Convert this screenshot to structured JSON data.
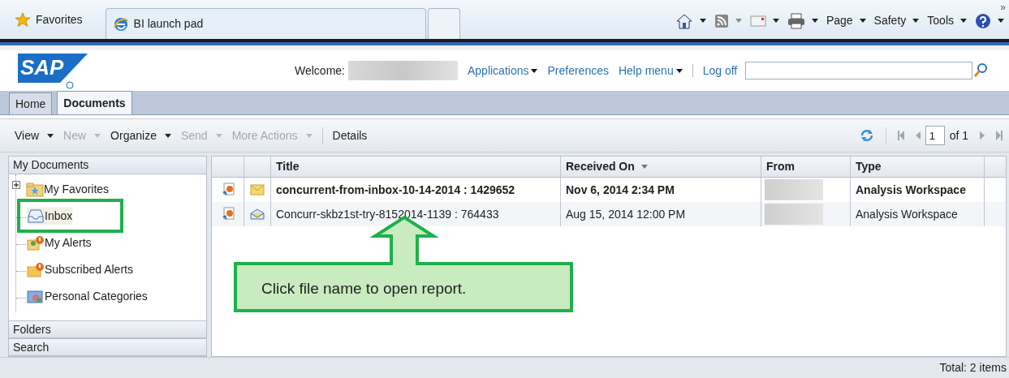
{
  "browser": {
    "favorites": "Favorites",
    "tabs": [
      {
        "label": "BI launch pad",
        "selected": true
      },
      {
        "selected": false
      }
    ],
    "commands": [
      {
        "kind": "home"
      },
      {
        "kind": "feed"
      },
      {
        "kind": "mail"
      },
      {
        "kind": "print"
      },
      {
        "kind": "menu",
        "label": "Page"
      },
      {
        "kind": "menu",
        "label": "Safety"
      },
      {
        "kind": "menu",
        "label": "Tools"
      },
      {
        "kind": "help"
      }
    ],
    "overflow": "»"
  },
  "header": {
    "logo": "SAP",
    "welcome": "Welcome:",
    "links": [
      {
        "label": "Applications",
        "menu": true
      },
      {
        "label": "Preferences",
        "menu": false
      },
      {
        "label": "Help menu",
        "menu": true
      },
      {
        "label": "Log off",
        "menu": false
      }
    ]
  },
  "app_tabs": [
    {
      "label": "Home",
      "selected": false
    },
    {
      "label": "Documents",
      "selected": true
    }
  ],
  "toolbar": {
    "items": [
      {
        "label": "View",
        "menu": true,
        "disabled": false
      },
      {
        "label": "New",
        "menu": true,
        "disabled": true
      },
      {
        "label": "Organize",
        "menu": true,
        "disabled": false
      },
      {
        "label": "Send",
        "menu": true,
        "disabled": true
      },
      {
        "label": "More Actions",
        "menu": true,
        "disabled": true
      },
      {
        "label": "Details",
        "menu": false,
        "disabled": false
      }
    ],
    "page": "1",
    "page_total": "of 1"
  },
  "sidebar": {
    "sections": [
      "My Documents",
      "Folders",
      "Search"
    ],
    "items": [
      {
        "label": "My Favorites",
        "kind": "favorites",
        "expandable": true,
        "selected": false
      },
      {
        "label": "Inbox",
        "kind": "inbox",
        "expandable": false,
        "selected": true
      },
      {
        "label": "My Alerts",
        "kind": "alerts",
        "expandable": false,
        "selected": false
      },
      {
        "label": "Subscribed Alerts",
        "kind": "subscribed",
        "expandable": false,
        "selected": false
      },
      {
        "label": "Personal Categories",
        "kind": "categories",
        "expandable": false,
        "selected": false
      }
    ]
  },
  "table": {
    "columns": [
      {
        "label": "Title",
        "sorted": false
      },
      {
        "label": "Received On",
        "sorted": true
      },
      {
        "label": "From",
        "sorted": false
      },
      {
        "label": "Type",
        "sorted": false
      }
    ],
    "rows": [
      {
        "title": "concurrent-from-inbox-10-14-2014 : 1429652",
        "received": "Nov 6, 2014 2:34 PM",
        "type": "Analysis Workspace",
        "unread": true
      },
      {
        "title": "Concurr-skbz1st-try-8152014-1139 : 764433",
        "received": "Aug 15, 2014 12:00 PM",
        "type": "Analysis Workspace",
        "unread": false
      }
    ]
  },
  "callout": "Click file name to open report.",
  "status_bar": "Total: 2 items"
}
